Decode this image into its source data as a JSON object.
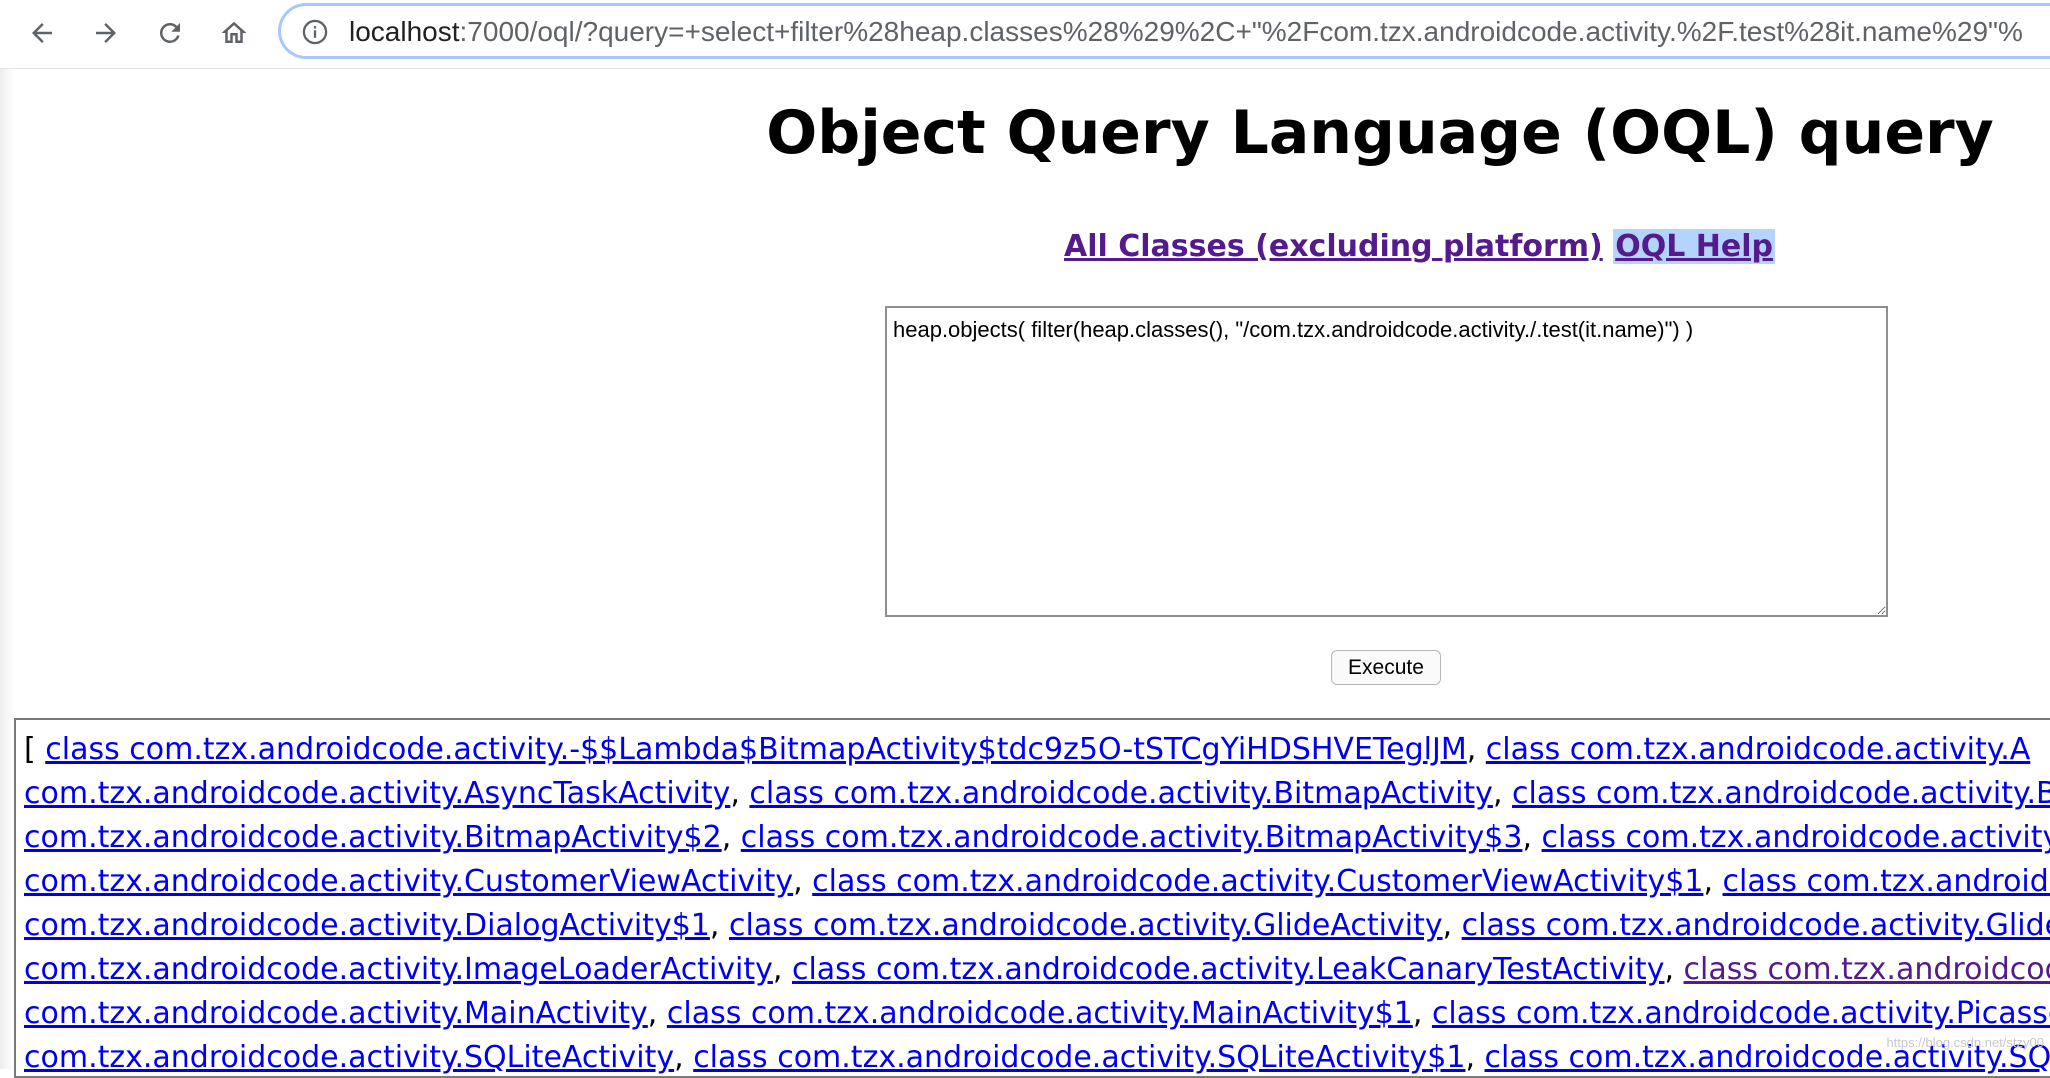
{
  "browser": {
    "url_host": "localhost",
    "url_rest": ":7000/oql/?query=+select+filter%28heap.classes%28%29%2C+\"%2Fcom.tzx.androidcode.activity.%2F.test%28it.name%29\"%",
    "icons": [
      "back-arrow-icon",
      "forward-arrow-icon",
      "reload-icon",
      "home-icon",
      "info-icon"
    ]
  },
  "page": {
    "title": "Object Query Language (OQL) query",
    "links": {
      "all_classes": "All Classes (excluding platform)",
      "oql_help": "OQL Help"
    },
    "query_text": "heap.objects( filter(heap.classes(), \"/com.tzx.androidcode.activity./.test(it.name)\") )",
    "execute_label": "Execute"
  },
  "results": {
    "open_bracket": "[",
    "lines": [
      [
        {
          "text": "class com.tzx.androidcode.activity.-$$Lambda$BitmapActivity$tdc9z5O-tSTCgYiHDSHVETeglJM",
          "sep": ","
        },
        {
          "text": "class com.tzx.androidcode.activity.A",
          "sep": ""
        }
      ],
      [
        {
          "text": "com.tzx.androidcode.activity.AsyncTaskActivity",
          "sep": ","
        },
        {
          "text": "class com.tzx.androidcode.activity.BitmapActivity",
          "sep": ","
        },
        {
          "text": "class com.tzx.androidcode.activity.Bit",
          "sep": ""
        }
      ],
      [
        {
          "text": "com.tzx.androidcode.activity.BitmapActivity$2",
          "sep": ","
        },
        {
          "text": "class com.tzx.androidcode.activity.BitmapActivity$3",
          "sep": ","
        },
        {
          "text": "class com.tzx.androidcode.activity.B",
          "sep": ""
        }
      ],
      [
        {
          "text": "com.tzx.androidcode.activity.CustomerViewActivity",
          "sep": ","
        },
        {
          "text": "class com.tzx.androidcode.activity.CustomerViewActivity$1",
          "sep": ","
        },
        {
          "text": "class com.tzx.androidcod",
          "sep": ""
        }
      ],
      [
        {
          "text": "com.tzx.androidcode.activity.DialogActivity$1",
          "sep": ","
        },
        {
          "text": "class com.tzx.androidcode.activity.GlideActivity",
          "sep": ","
        },
        {
          "text": "class com.tzx.androidcode.activity.GlideAc",
          "sep": ""
        }
      ],
      [
        {
          "text": "com.tzx.androidcode.activity.ImageLoaderActivity",
          "sep": ","
        },
        {
          "text": "class com.tzx.androidcode.activity.LeakCanaryTestActivity",
          "sep": ","
        },
        {
          "text": "class com.tzx.androidcode",
          "sep": "",
          "visited": true
        }
      ],
      [
        {
          "text": "com.tzx.androidcode.activity.MainActivity",
          "sep": ","
        },
        {
          "text": "class com.tzx.androidcode.activity.MainActivity$1",
          "sep": ","
        },
        {
          "text": "class com.tzx.androidcode.activity.PicassoA",
          "sep": ""
        }
      ],
      [
        {
          "text": "com.tzx.androidcode.activity.SQLiteActivity",
          "sep": ","
        },
        {
          "text": "class com.tzx.androidcode.activity.SQLiteActivity$1",
          "sep": ","
        },
        {
          "text": "class com.tzx.androidcode.activity.SQLi",
          "sep": ""
        }
      ]
    ]
  },
  "watermark": "https://blog.csdn.net/stzy00"
}
